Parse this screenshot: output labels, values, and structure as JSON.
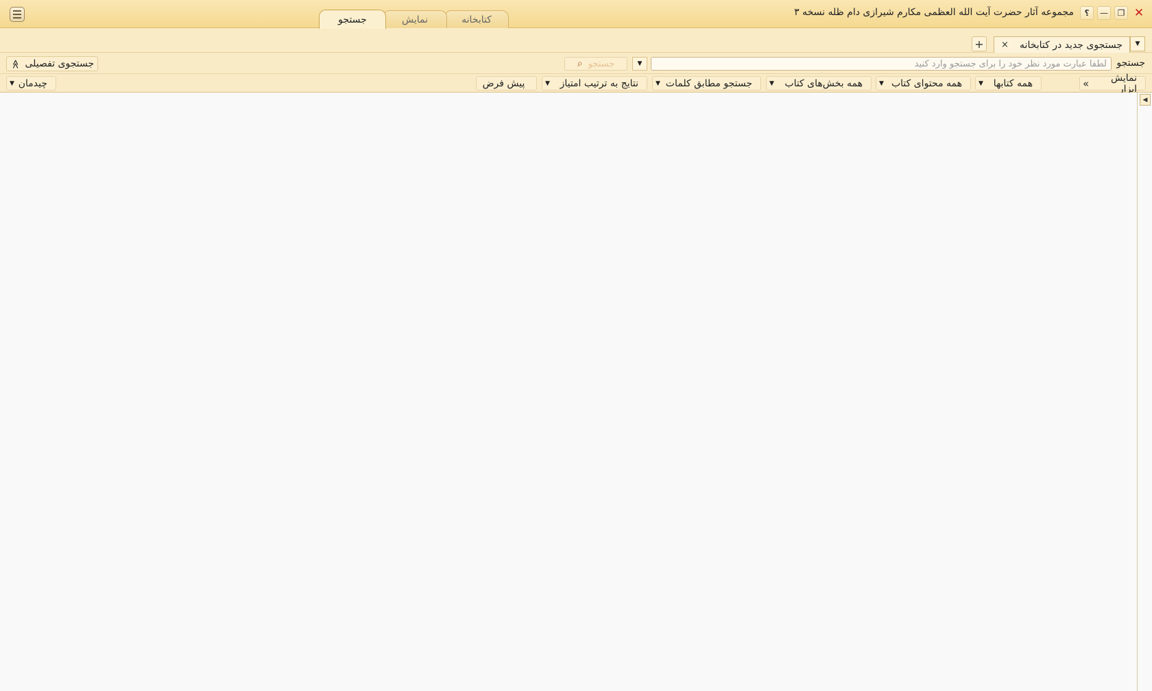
{
  "window": {
    "title": "مجموعه آثار حضرت آیت الله العظمی مکارم شیرازی دام ظله نسخه ۳",
    "close_icon": "✕",
    "restore_icon": "❐",
    "minimize_icon": "—",
    "help_icon": "؟"
  },
  "ribbon": {
    "tabs": [
      "کتابخانه",
      "نمایش",
      "جستجو"
    ],
    "active_tab": "جستجو"
  },
  "doc_tabs": {
    "active_label": "جستجوی جدید در کتابخانه",
    "close_icon": "×",
    "add_icon": "+",
    "dropdown_icon": "▼"
  },
  "search": {
    "label": "جستجو",
    "placeholder": "لطفا عبارت مورد نظر خود را برای جستجو وارد کنید",
    "value": "",
    "history_icon": "▼",
    "go_label": "جستجو",
    "advanced_label": "جستجوی تفصیلی",
    "advanced_icon": "≫"
  },
  "filters": {
    "show_tools": "نمایش ابزار",
    "show_tools_icon": "«",
    "books": "همه کتابها",
    "content": "همه محتوای کتاب",
    "sections": "همه بخش‌های کتاب",
    "match": "جستجو مطابق کلمات",
    "sort": "نتایج به ترتیب امتیاز",
    "default": "پیش فرض",
    "layout": "چیدمان",
    "arrow": "▼"
  },
  "side_panel": {
    "toggle_icon": "◀"
  }
}
